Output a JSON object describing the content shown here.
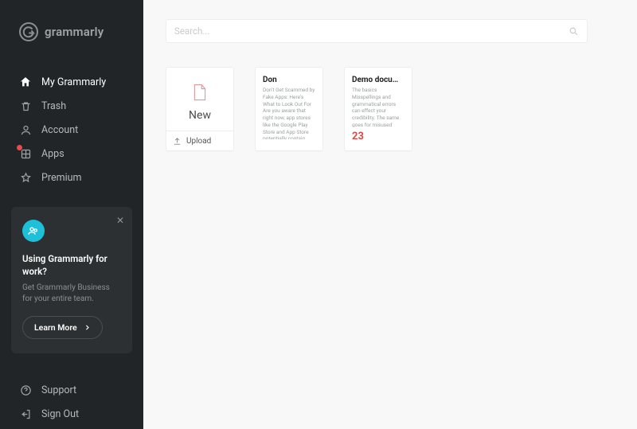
{
  "brand": "grammarly",
  "search": {
    "placeholder": "Search..."
  },
  "nav": {
    "my_grammarly": "My Grammarly",
    "trash": "Trash",
    "account": "Account",
    "apps": "Apps",
    "premium": "Premium",
    "support": "Support",
    "signout": "Sign Out"
  },
  "promo": {
    "title": "Using Grammarly for work?",
    "subtitle": "Get Grammarly Business for your entire team.",
    "cta": "Learn More"
  },
  "cards": {
    "new_label": "New",
    "upload_label": "Upload",
    "documents": [
      {
        "title": "Don",
        "body": "Don't Get Scammed by Fake Apps: Here's What to Look Out For Are you aware that right now, app stores like the Google Play Store and App Store potentially contain fake",
        "score": ""
      },
      {
        "title": "Demo document",
        "body": "The basics Misspellings and grammatical errors can effect your credibility. The same goes for misused commas, and other",
        "score": "23"
      }
    ]
  }
}
